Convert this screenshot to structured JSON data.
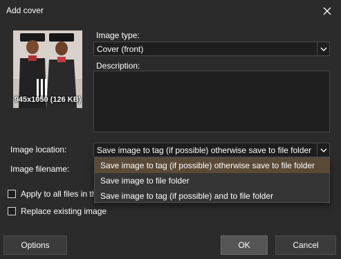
{
  "dialog": {
    "title": "Add cover"
  },
  "cover": {
    "caption": "945x1050 (126 KB)"
  },
  "image_type": {
    "label": "Image type:",
    "value": "Cover (front)"
  },
  "description": {
    "label": "Description:",
    "value": ""
  },
  "image_location": {
    "label": "Image location:",
    "value": "Save image to tag (if possible) otherwise save to file folder",
    "options": [
      "Save image to tag (if possible) otherwise save to file folder",
      "Save image to file folder",
      "Save image to tag (if possible) and to file folder"
    ],
    "selected_index": 0
  },
  "image_filename": {
    "label": "Image filename:"
  },
  "checkboxes": {
    "apply_all": {
      "label": "Apply to all files in th",
      "checked": false
    },
    "replace": {
      "label": "Replace existing image",
      "checked": false
    }
  },
  "buttons": {
    "options": "Options",
    "ok": "OK",
    "cancel": "Cancel"
  },
  "colors": {
    "background": "#2b2b2b",
    "selection": "#5a4a37",
    "field": "#1e1e1e"
  },
  "icons": {
    "close": "close-icon",
    "chevron": "chevron-down-icon"
  }
}
